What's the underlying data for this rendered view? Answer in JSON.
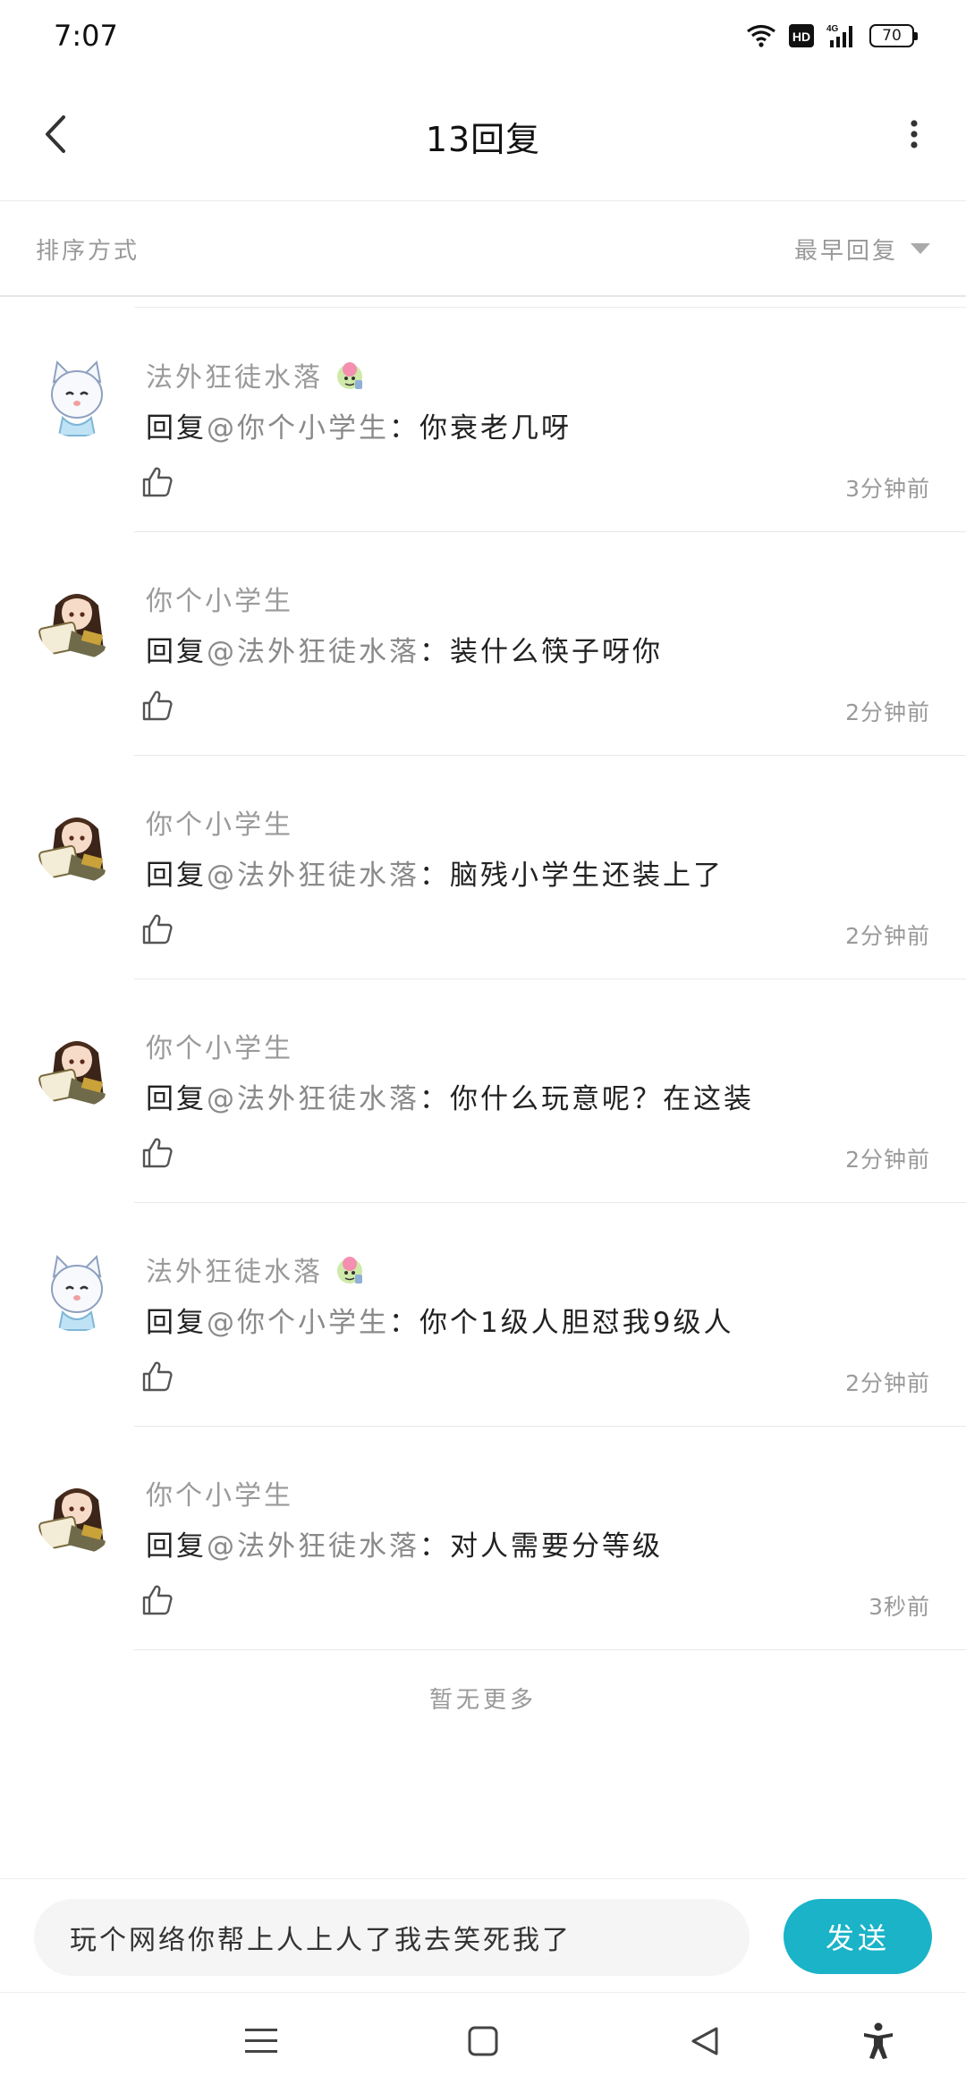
{
  "status_bar": {
    "time": "7:07",
    "battery": "70",
    "network": "4G",
    "hd": "HD"
  },
  "header": {
    "title": "13回复"
  },
  "sort": {
    "label": "排序方式",
    "selected": "最早回复"
  },
  "comments": [
    {
      "user": "法外狂徒水落",
      "has_badge": true,
      "reply_prefix": "回复",
      "reply_to": "@你个小学生",
      "text": "：你衰老几呀",
      "time": "3分钟前",
      "avatar": "white-cat"
    },
    {
      "user": "你个小学生",
      "has_badge": false,
      "reply_prefix": "回复",
      "reply_to": "@法外狂徒水落",
      "text": "：装什么筷子呀你",
      "time": "2分钟前",
      "avatar": "dark-hair-girl"
    },
    {
      "user": "你个小学生",
      "has_badge": false,
      "reply_prefix": "回复",
      "reply_to": "@法外狂徒水落",
      "text": "：脑残小学生还装上了",
      "time": "2分钟前",
      "avatar": "dark-hair-girl"
    },
    {
      "user": "你个小学生",
      "has_badge": false,
      "reply_prefix": "回复",
      "reply_to": "@法外狂徒水落",
      "text": "：你什么玩意呢？在这装",
      "time": "2分钟前",
      "avatar": "dark-hair-girl"
    },
    {
      "user": "法外狂徒水落",
      "has_badge": true,
      "reply_prefix": "回复",
      "reply_to": "@你个小学生",
      "text": "：你个1级人胆怼我9级人",
      "time": "2分钟前",
      "avatar": "white-cat"
    },
    {
      "user": "你个小学生",
      "has_badge": false,
      "reply_prefix": "回复",
      "reply_to": "@法外狂徒水落",
      "text": "：对人需要分等级",
      "time": "3秒前",
      "avatar": "dark-hair-girl"
    }
  ],
  "footer_note": "暂无更多",
  "composer": {
    "value": "玩个网络你帮上人上人了我去笑死我了",
    "send_label": "发送"
  },
  "colors": {
    "accent": "#1ab3c8",
    "muted": "#999999"
  },
  "icons": {
    "back": "chevron-left-icon",
    "more": "more-vertical-icon",
    "like": "thumbs-up-icon",
    "sort_caret": "caret-down-icon"
  }
}
